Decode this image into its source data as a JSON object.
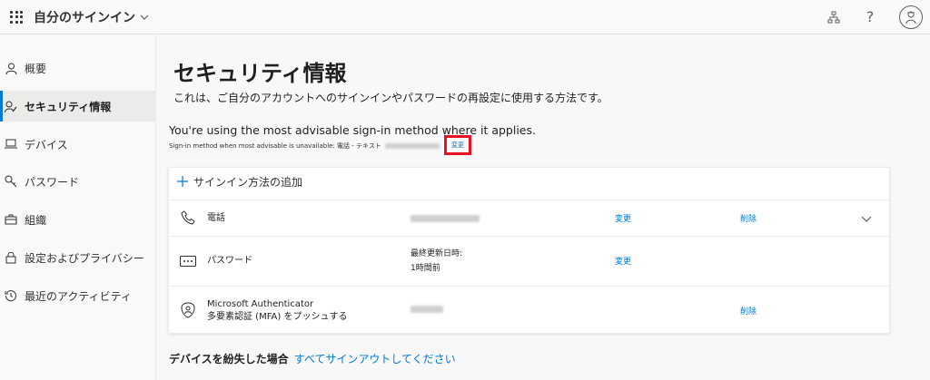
{
  "header": {
    "app_title": "自分のサインイン",
    "icons": [
      "waffle-icon",
      "chevron-down-icon",
      "org-chart-icon",
      "help-icon",
      "avatar"
    ],
    "help_glyph": "?"
  },
  "sidebar": {
    "items": [
      {
        "label": "概要",
        "icon": "person-icon",
        "active": false
      },
      {
        "label": "セキュリティ情報",
        "icon": "security-info-icon",
        "active": true
      },
      {
        "label": "デバイス",
        "icon": "laptop-icon",
        "active": false
      },
      {
        "label": "パスワード",
        "icon": "key-icon",
        "active": false
      },
      {
        "label": "組織",
        "icon": "briefcase-icon",
        "active": false
      },
      {
        "label": "設定およびプライバシー",
        "icon": "lock-icon",
        "active": false
      },
      {
        "label": "最近のアクティビティ",
        "icon": "history-icon",
        "active": false
      }
    ]
  },
  "main": {
    "title": "セキュリティ情報",
    "description": "これは、ご自分のアカウントへのサインインやパスワードの再設定に使用する方法です。",
    "advisable": "You're using the most advisable sign-in method where it applies.",
    "advisable_sub_prefix": "Sign-in method when most advisable is unavailable: 電話 - テキスト",
    "advisable_change": "変更",
    "add_method": "サインイン方法の追加",
    "methods": [
      {
        "name": "電話",
        "icon": "phone-icon",
        "change": "変更",
        "delete": "削除"
      },
      {
        "name": "パスワード",
        "icon": "password-dots-icon",
        "value_line1": "最終更新日時:",
        "value_line2": "1時間前",
        "change": "変更"
      },
      {
        "name_line1": "Microsoft Authenticator",
        "name_line2": "多要素認証 (MFA) をプッシュする",
        "icon": "authenticator-icon",
        "delete": "削除"
      }
    ],
    "lost_device": "デバイスを紛失した場合",
    "sign_out_all": "すべてサインアウトしてください"
  },
  "colors": {
    "accent": "#0078d4",
    "highlight_box": "#e81123",
    "text": "#201f1e"
  }
}
